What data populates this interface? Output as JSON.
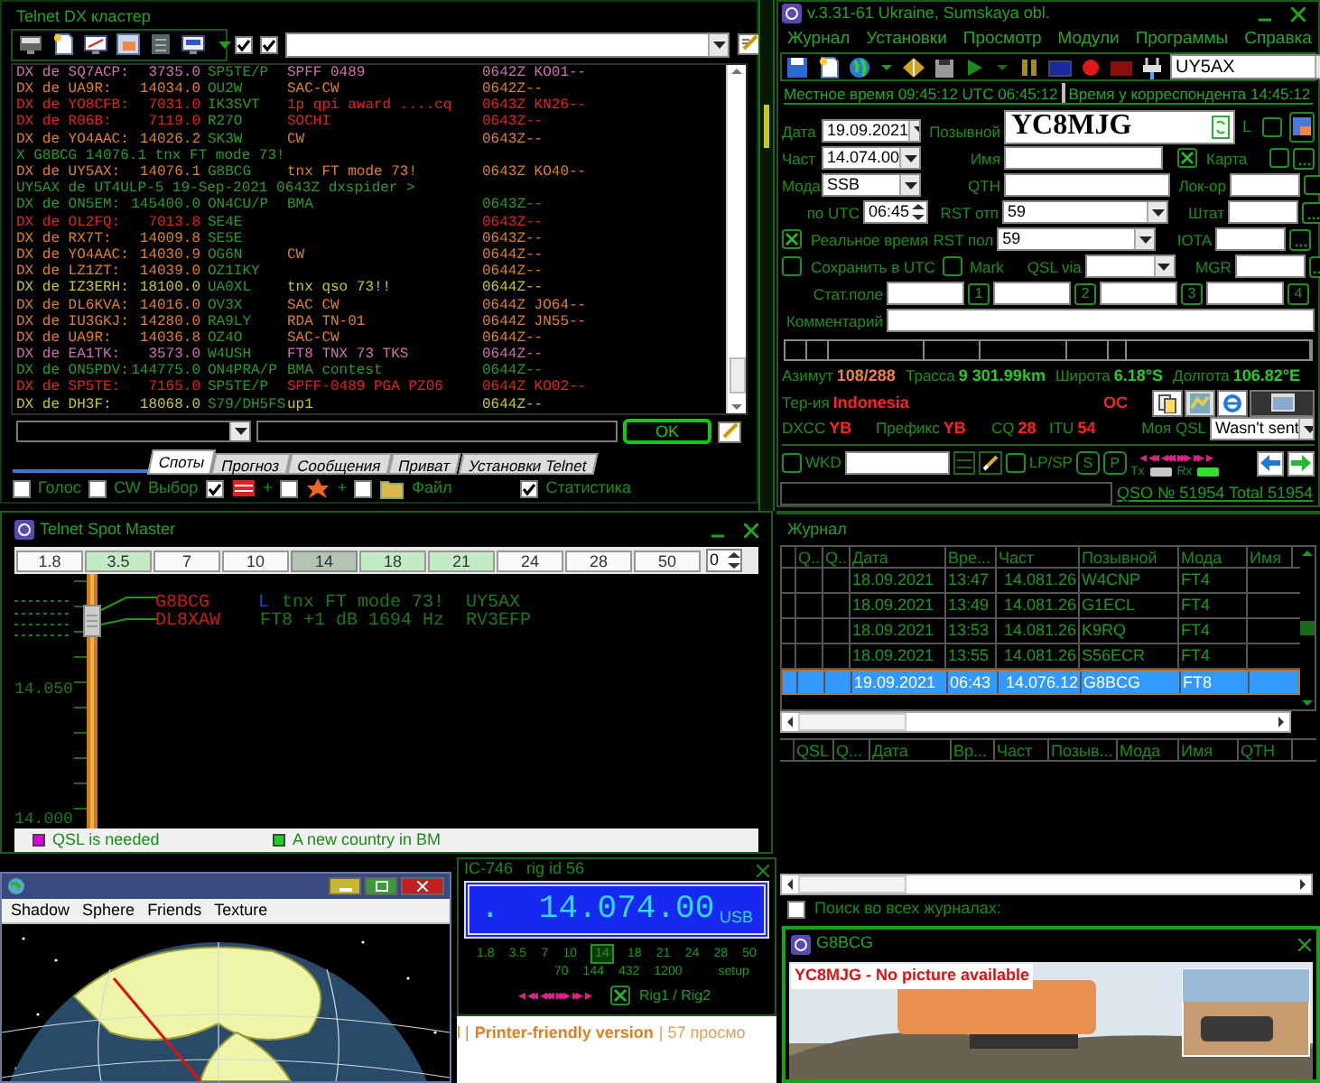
{
  "cluster": {
    "title": "Telnet DX кластер",
    "filter_checks": [
      {
        "checked": true
      },
      {
        "checked": true
      }
    ],
    "lines": [
      {
        "kind": "spot",
        "color": "#d070b0",
        "spotter": "DX de SQ7ACP:",
        "freq": "3735.0",
        "dx": "SP5TE/P",
        "comment": "SPFF 0489",
        "time": "0642Z KO01--"
      },
      {
        "kind": "spot",
        "color": "#e08020",
        "spotter": "DX de UA9R:",
        "freq": "14034.0",
        "dx": "OU2W",
        "comment": "SAC-CW",
        "time": "0642Z--"
      },
      {
        "kind": "spot",
        "color": "#e82020",
        "spotter": "DX de YO8CFB:",
        "freq": "7031.0",
        "dx": "IK3SVT",
        "comment": "1p qpi  award ....cq",
        "time": "0643Z KN26--"
      },
      {
        "kind": "spot",
        "color": "#e82020",
        "spotter": "DX de R06B:",
        "freq": "7119.0",
        "dx": "R27O",
        "comment": "SOCHI",
        "time": "0643Z--"
      },
      {
        "kind": "spot",
        "color": "#e08020",
        "spotter": "DX de YO4AAC:",
        "freq": "14026.2",
        "dx": "SK3W",
        "comment": "CW",
        "time": "0643Z--"
      },
      {
        "kind": "message",
        "color": "#2a9a2a",
        "text": "X G8BCG 14076.1 tnx  FT mode 73!"
      },
      {
        "kind": "spot",
        "color": "#e08020",
        "spotter": "DX de UY5AX:",
        "freq": "14076.1",
        "dx": "G8BCG",
        "comment": "tnx  FT mode 73!",
        "time": "0643Z KO40--"
      },
      {
        "kind": "message",
        "color": "#2a9a2a",
        "text": "UY5AX de UT4ULP-5 19-Sep-2021 0643Z dxspider >"
      },
      {
        "kind": "spot",
        "color": "#2a9a2a",
        "spotter": "DX de ON5EM:",
        "freq": "145400.0",
        "dx": "ON4CU/P",
        "comment": "BMA",
        "time": "0643Z--"
      },
      {
        "kind": "spot",
        "color": "#e82020",
        "spotter": "DX de OL2FQ:",
        "freq": "7013.8",
        "dx": "SE4E",
        "time": "0643Z--"
      },
      {
        "kind": "spot",
        "color": "#e08020",
        "spotter": "DX de RX7T:",
        "freq": "14009.8",
        "dx": "SE5E",
        "time": "0643Z--"
      },
      {
        "kind": "spot",
        "color": "#e08020",
        "spotter": "DX de YO4AAC:",
        "freq": "14030.9",
        "dx": "OG6N",
        "comment": "CW",
        "time": "0644Z--"
      },
      {
        "kind": "spot",
        "color": "#e08020",
        "spotter": "DX de LZ1ZT:",
        "freq": "14039.0",
        "dx": "OZ1IKY",
        "time": "0644Z--"
      },
      {
        "kind": "spot",
        "color": "#c8c820",
        "spotter": "DX de IZ3ERH:",
        "freq": "18100.0",
        "dx": "UA0XL",
        "comment": "tnx qso 73!!",
        "time": "0644Z--"
      },
      {
        "kind": "spot",
        "color": "#e08020",
        "spotter": "DX de DL6KVA:",
        "freq": "14016.0",
        "dx": "OV3X",
        "comment": "SAC CW",
        "time": "0644Z JO64--"
      },
      {
        "kind": "spot",
        "color": "#e08020",
        "spotter": "DX de IU3GKJ:",
        "freq": "14280.0",
        "dx": "RA9LY",
        "comment": "RDA TN-01",
        "time": "0644Z JN55--"
      },
      {
        "kind": "spot",
        "color": "#e08020",
        "spotter": "DX de UA9R:",
        "freq": "14036.8",
        "dx": "OZ4O",
        "comment": "SAC-CW",
        "time": "0644Z--"
      },
      {
        "kind": "spot",
        "color": "#d070b0",
        "spotter": "DX de EA1TK:",
        "freq": "3573.0",
        "dx": "W4USH",
        "comment": "FT8  TNX  73  TKS",
        "time": "0644Z--"
      },
      {
        "kind": "spot",
        "color": "#2a9a2a",
        "spotter": "DX de ON5PDV:",
        "freq": "144775.0",
        "dx": "ON4PRA/P",
        "comment": "BMA contest",
        "time": "0644Z--"
      },
      {
        "kind": "spot",
        "color": "#e82020",
        "spotter": "DX de SP5TE:",
        "freq": "7165.0",
        "dx": "SP5TE/P",
        "comment": "SPFF-0489 PGA PZ06",
        "time": "0644Z KO02--"
      },
      {
        "kind": "spot",
        "color": "#c8c820",
        "spotter": "DX de DH3F:",
        "freq": "18068.0",
        "dx": "S79/DH5FS",
        "comment": "up1",
        "time": "0644Z--"
      }
    ],
    "ok": "OK",
    "tabs": [
      {
        "label": "Споты",
        "selected": true
      },
      {
        "label": "Прогноз",
        "selected": false
      },
      {
        "label": "Сообщения",
        "selected": false
      },
      {
        "label": "Приват",
        "selected": false
      },
      {
        "label": "Установки Telnet",
        "selected": false
      }
    ],
    "options": [
      {
        "kind": "check",
        "label": "Голос",
        "checked": false
      },
      {
        "kind": "check",
        "label": "CW",
        "checked": false
      },
      {
        "kind": "text",
        "label": "Выбор"
      },
      {
        "kind": "box",
        "checked": true
      },
      {
        "kind": "text",
        "label": "+"
      },
      {
        "kind": "box",
        "checked": false
      },
      {
        "kind": "text",
        "label": "+"
      },
      {
        "kind": "box",
        "checked": false
      },
      {
        "kind": "text",
        "label": "Файл"
      },
      {
        "kind": "check",
        "label": "Статистика",
        "checked": true
      }
    ]
  },
  "logger": {
    "title": "v.3.31-61 Ukraine, Sumskaya obl.",
    "menu": [
      "Журнал",
      "Установки",
      "Просмотр",
      "Модули",
      "Программы",
      "Справка"
    ],
    "operator": "UY5AX",
    "clock": {
      "local_label": "Местное время",
      "local": "09:45:12",
      "utc_label": "UTC",
      "utc": "06:45:12",
      "remote_label": "Время у корреспондента",
      "remote": "14:45:12"
    },
    "date": {
      "label": "Дата",
      "value": "19.09.2021"
    },
    "freq": {
      "label": "Част",
      "value": "14.074.00"
    },
    "mode": {
      "label": "Мода",
      "value": "SSB"
    },
    "utc_time": {
      "label": "по UTC",
      "value": "06:45"
    },
    "realtime": {
      "label": "Реальное время",
      "checked": true
    },
    "save_utc": {
      "label": "Сохранить в UTC",
      "checked": false
    },
    "mark": {
      "label": "Mark",
      "checked": false
    },
    "callsign": {
      "label": "Позывной",
      "value": "YC8MJG"
    },
    "flag": "L",
    "flag_check": {
      "checked": false
    },
    "name": {
      "label": "Имя"
    },
    "qth": {
      "label": "QTH"
    },
    "rst_sent": {
      "label": "RST отп",
      "value": "59"
    },
    "rst_rcvd": {
      "label": "RST пол",
      "value": "59"
    },
    "qsl_via": {
      "label": "QSL via"
    },
    "map": {
      "label": "Карта",
      "checked": true
    },
    "map_extra": {
      "checked": false
    },
    "locator": {
      "label": "Лок-ор",
      "checked": false
    },
    "state": {
      "label": "Штат"
    },
    "iota": {
      "label": "IOTA"
    },
    "mgr": {
      "label": "MGR"
    },
    "stat": {
      "label": "Стат.поле",
      "buttons": [
        "1",
        "2",
        "3",
        "4"
      ]
    },
    "comment": {
      "label": "Комментарий"
    },
    "info": [
      [
        {
          "label": "Азимут",
          "value": "108/288",
          "color": "#f08040"
        },
        {
          "label": "Трасса",
          "value": "9 301.99km",
          "color": "#22cc22"
        },
        {
          "label": "Широта",
          "value": "6.18°S",
          "color": "#22cc22"
        },
        {
          "label": "Долгота",
          "value": "106.82°E",
          "color": "#22cc22"
        }
      ],
      [
        {
          "label": "Тер-ия",
          "value": "Indonesia",
          "color": "#ff2020"
        },
        {
          "value": "OC",
          "color": "#ff2020"
        }
      ],
      [
        {
          "label": "DXCC",
          "value": "YB",
          "color": "#ff2020"
        },
        {
          "label": "Префикс",
          "value": "YB",
          "color": "#ff2020"
        },
        {
          "label": "CQ",
          "value": "28",
          "color": "#ff2020"
        },
        {
          "label": "ITU",
          "value": "54",
          "color": "#ff2020"
        }
      ]
    ],
    "my_qsl": {
      "label": "Моя QSL",
      "value": "Wasn't sent"
    },
    "wkd": {
      "label": "WKD",
      "checked": false
    },
    "lpsp": {
      "label": "LP/SP",
      "checked": false
    },
    "buttons": [
      "S",
      "P"
    ],
    "arrows": [
      "◂",
      "◂◂",
      "◂◂◂",
      "▸▸▸",
      "▸▸",
      "▸"
    ],
    "tx": {
      "label": "Tx",
      "on": false
    },
    "rx": {
      "label": "Rx",
      "on": true
    },
    "total": "QSO № 51954 Total 51954"
  },
  "spot_master": {
    "title": "Telnet Spot Master",
    "bands": [
      {
        "label": "1.8",
        "selected": false,
        "active": false
      },
      {
        "label": "3.5",
        "selected": false,
        "active": true
      },
      {
        "label": "7",
        "selected": false,
        "active": false
      },
      {
        "label": "10",
        "selected": false,
        "active": false
      },
      {
        "label": "14",
        "selected": true,
        "active": false
      },
      {
        "label": "18",
        "selected": false,
        "active": true
      },
      {
        "label": "21",
        "selected": false,
        "active": true
      },
      {
        "label": "24",
        "selected": false,
        "active": false
      },
      {
        "label": "28",
        "selected": false,
        "active": false
      },
      {
        "label": "50",
        "selected": false,
        "active": false
      }
    ],
    "step": "0",
    "scale_labels": [
      "14.050",
      "14.000"
    ],
    "spots": [
      {
        "call": "G8BCG",
        "flag": "L",
        "comment": "tnx  FT mode 73!",
        "spotter": "UY5AX"
      },
      {
        "call": "DL8XAW",
        "comment": "FT8 +1 dB 1694 Hz",
        "spotter": "RV3EFP"
      }
    ],
    "legend": [
      {
        "label": "QSL is needed",
        "color": "#e000e0"
      },
      {
        "label": "A new country in BM",
        "color": "#20d020"
      }
    ]
  },
  "journal": {
    "title": "Журнал",
    "columns": [
      "Q..",
      "Q..",
      "Дата",
      "Вре...",
      "Част",
      "Позывной",
      "Мода",
      "Имя"
    ],
    "rows": [
      {
        "date": "18.09.2021",
        "time": "13:47",
        "freq": "14.081.26",
        "call": "W4CNP",
        "mode": "FT4",
        "selected": false
      },
      {
        "date": "18.09.2021",
        "time": "13:49",
        "freq": "14.081.26",
        "call": "G1ECL",
        "mode": "FT4",
        "selected": false
      },
      {
        "date": "18.09.2021",
        "time": "13:53",
        "freq": "14.081.26",
        "call": "K9RQ",
        "mode": "FT4",
        "selected": false
      },
      {
        "date": "18.09.2021",
        "time": "13:55",
        "freq": "14.081.26",
        "call": "S56ECR",
        "mode": "FT4",
        "selected": false
      },
      {
        "date": "19.09.2021",
        "time": "06:43",
        "freq": "14.076.12",
        "call": "G8BCG",
        "mode": "FT8",
        "selected": true
      }
    ],
    "columns2": [
      "QSL",
      "Q...",
      "Дата",
      "Вр...",
      "Част",
      "Позыв...",
      "Мода",
      "Имя",
      "QTH"
    ],
    "search_all": {
      "label": "Поиск во всех журналах:",
      "checked": false
    }
  },
  "globe": {
    "menu": [
      "Shadow",
      "Sphere",
      "Friends",
      "Texture"
    ]
  },
  "rig": {
    "title": "IC-746   rig id 56",
    "freq": ".  14.074.00",
    "mode": "USB",
    "bands": [
      {
        "label": "1.8",
        "selected": false
      },
      {
        "label": "3.5",
        "selected": false
      },
      {
        "label": "7",
        "selected": false
      },
      {
        "label": "10",
        "selected": false
      },
      {
        "label": "14",
        "selected": true
      },
      {
        "label": "18",
        "selected": false
      },
      {
        "label": "21",
        "selected": false
      },
      {
        "label": "24",
        "selected": false
      },
      {
        "label": "28",
        "selected": false
      },
      {
        "label": "50",
        "selected": false
      }
    ],
    "bands2": [
      "70",
      "144",
      "432",
      "1200"
    ],
    "setup": "setup",
    "arrows": [
      "◂",
      "◂◂",
      "◂◂◂",
      "▸▸▸",
      "▸▸",
      "▸"
    ],
    "rig_switch": {
      "label": "Rig1 / Rig2",
      "checked": true
    }
  },
  "browser": {
    "lead": "l |",
    "link": "Printer-friendly version",
    "tail": "| 57 просмо"
  },
  "qsl_window": {
    "title": "G8BCG",
    "notice": "YC8MJG - No picture available"
  }
}
